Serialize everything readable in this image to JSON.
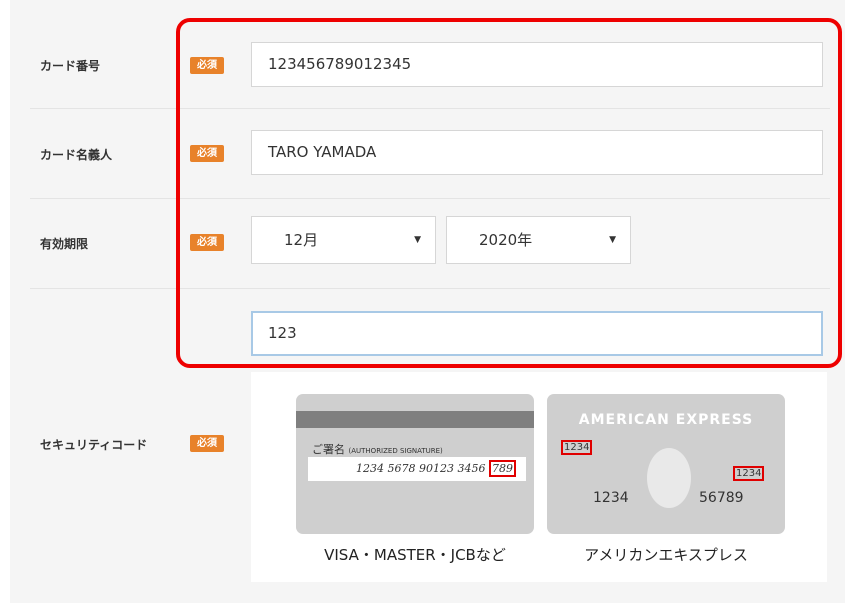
{
  "form": {
    "required_badge": "必須",
    "card_number": {
      "label": "カード番号",
      "value": "123456789012345"
    },
    "card_holder": {
      "label": "カード名義人",
      "value": "TARO YAMADA"
    },
    "expiry": {
      "label": "有効期限",
      "month": "12月",
      "year": "2020年"
    },
    "security_code": {
      "label": "セキュリティコード",
      "value": "123"
    }
  },
  "cards": {
    "visa": {
      "signature_label": "ご署名",
      "signature_sub": "(AUTHORIZED SIGNATURE)",
      "number_text": "1234 5678 90123 3456",
      "cvv": "789",
      "caption": "VISA・MASTER・JCBなど"
    },
    "amex": {
      "title": "AMERICAN EXPRESS",
      "code_left": "1234",
      "code_right": "1234",
      "num_left": "1234",
      "num_right": "56789",
      "caption": "アメリカンエキスプレス"
    }
  },
  "colors": {
    "badge": "#e8822a",
    "highlight": "#ee0000",
    "panel": "#f5f5f5"
  }
}
